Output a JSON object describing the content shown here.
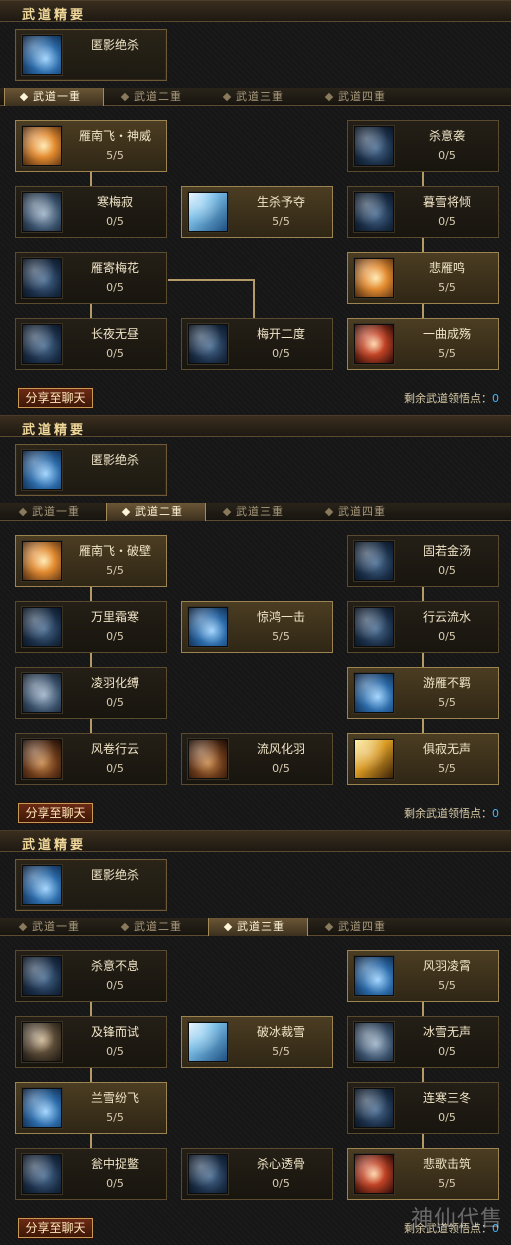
{
  "header_label": "武道精要",
  "essence_skill": "匿影绝杀",
  "tabs": [
    "武道一重",
    "武道二重",
    "武道三重",
    "武道四重"
  ],
  "share_label": "分享至聊天",
  "remaining_label": "剩余武道领悟点：",
  "remaining_value": "0",
  "watermark": "神仙代售",
  "panels": [
    {
      "active_tab": 0,
      "nodes": [
        {
          "name": "雁南飞・神威",
          "level": "5/5",
          "icon": "fire"
        },
        {
          "name": "杀意袭",
          "level": "0/5",
          "icon": "dark"
        },
        {
          "name": "寒梅寂",
          "level": "0/5",
          "icon": "gray"
        },
        {
          "name": "生杀予夺",
          "level": "5/5",
          "icon": "ice"
        },
        {
          "name": "暮雪将倾",
          "level": "0/5",
          "icon": "dark"
        },
        {
          "name": "雁寄梅花",
          "level": "0/5",
          "icon": "dark"
        },
        {
          "name": "悲雁鸣",
          "level": "5/5",
          "icon": "fire"
        },
        {
          "name": "长夜无昼",
          "level": "0/5",
          "icon": "dark"
        },
        {
          "name": "梅开二度",
          "level": "0/5",
          "icon": "dark"
        },
        {
          "name": "一曲成殇",
          "level": "5/5",
          "icon": "red"
        }
      ]
    },
    {
      "active_tab": 1,
      "nodes": [
        {
          "name": "雁南飞・破壁",
          "level": "5/5",
          "icon": "fire"
        },
        {
          "name": "固若金汤",
          "level": "0/5",
          "icon": "dark"
        },
        {
          "name": "万里霜寒",
          "level": "0/5",
          "icon": "dark"
        },
        {
          "name": "惊鸿一击",
          "level": "5/5",
          "icon": "blue"
        },
        {
          "name": "行云流水",
          "level": "0/5",
          "icon": "dark"
        },
        {
          "name": "凌羽化缚",
          "level": "0/5",
          "icon": "gray"
        },
        {
          "name": "游雁不羁",
          "level": "5/5",
          "icon": "blue"
        },
        {
          "name": "风卷行云",
          "level": "0/5",
          "icon": "brown"
        },
        {
          "name": "流风化羽",
          "level": "0/5",
          "icon": "brown"
        },
        {
          "name": "俱寂无声",
          "level": "5/5",
          "icon": "gold"
        }
      ]
    },
    {
      "active_tab": 2,
      "nodes": [
        {
          "name": "杀意不息",
          "level": "0/5",
          "icon": "dark"
        },
        {
          "name": "风羽凌霄",
          "level": "5/5",
          "icon": "blue"
        },
        {
          "name": "及锋而试",
          "level": "0/5",
          "icon": "face"
        },
        {
          "name": "破冰裁雪",
          "level": "5/5",
          "icon": "ice"
        },
        {
          "name": "冰雪无声",
          "level": "0/5",
          "icon": "gray"
        },
        {
          "name": "兰雪纷飞",
          "level": "5/5",
          "icon": "blue"
        },
        {
          "name": "连寒三冬",
          "level": "0/5",
          "icon": "dark"
        },
        {
          "name": "瓮中捉鳖",
          "level": "0/5",
          "icon": "dark"
        },
        {
          "name": "杀心透骨",
          "level": "0/5",
          "icon": "dark"
        },
        {
          "name": "悲歌击筑",
          "level": "5/5",
          "icon": "red"
        }
      ]
    }
  ]
}
